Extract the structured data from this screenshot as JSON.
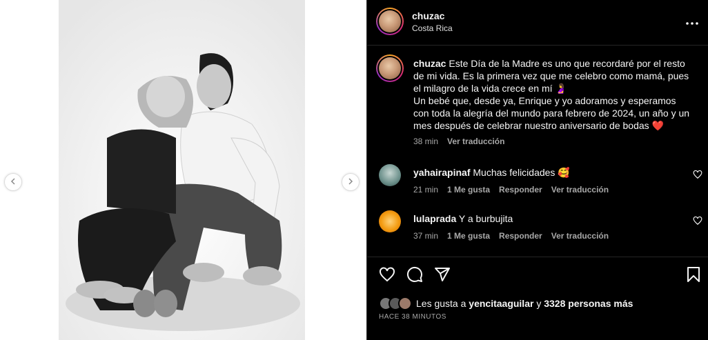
{
  "post": {
    "username": "chuzac",
    "location": "Costa Rica",
    "caption": {
      "username": "chuzac",
      "text": "Este Día de la Madre es uno que recordaré por el resto de mi vida. Es la primera vez que me celebro como mamá, pues el milagro de la vida crece en mí 🤰\nUn bebé que, desde ya, Enrique y yo adoramos y esperamos con toda la alegría del mundo para febrero de 2024, un año y un mes después de celebrar nuestro aniversario de bodas ❤️",
      "time": "38 min",
      "translate": "Ver traducción"
    }
  },
  "comments": [
    {
      "username": "yahairapinaf",
      "text": "Muchas felicidades 🥰",
      "time": "21 min",
      "likes": "1 Me gusta",
      "reply": "Responder",
      "translate": "Ver traducción",
      "avatar_color": "#6b8f8a"
    },
    {
      "username": "lulaprada",
      "text": "Y a burbujita",
      "time": "37 min",
      "likes": "1 Me gusta",
      "reply": "Responder",
      "translate": "Ver traducción",
      "avatar_color": "#f39c12"
    }
  ],
  "likes": {
    "prefix": "Les gusta a",
    "user": "yencitaaguilar",
    "conj": "y",
    "others": "3328 personas más"
  },
  "timestamp": "HACE 38 MINUTOS",
  "icons": {
    "prev": "chevron-left-icon",
    "next": "chevron-right-icon",
    "more": "more-horizontal-icon",
    "like": "heart-icon",
    "comment": "comment-icon",
    "share": "send-icon",
    "save": "bookmark-icon"
  },
  "colors": {
    "background": "#000000",
    "text": "#f5f5f5",
    "secondary": "#a8a8a8",
    "divider": "#262626"
  }
}
